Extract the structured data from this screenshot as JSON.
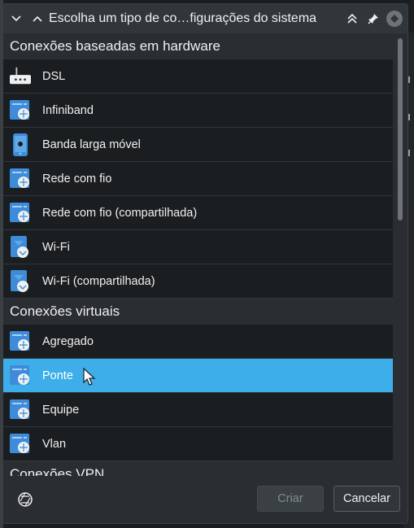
{
  "window": {
    "title": "Escolha um tipo de co…figurações do sistema",
    "buttons": {
      "create": "Criar",
      "cancel": "Cancelar"
    }
  },
  "sections": [
    {
      "title": "Conexões baseadas em hardware",
      "items": [
        {
          "label": "DSL",
          "icon": "dsl-modem-icon"
        },
        {
          "label": "Infiniband",
          "icon": "network-card-icon"
        },
        {
          "label": "Banda larga móvel",
          "icon": "mobile-phone-icon"
        },
        {
          "label": "Rede com fio",
          "icon": "wired-network-icon"
        },
        {
          "label": "Rede com fio (compartilhada)",
          "icon": "wired-network-icon"
        },
        {
          "label": "Wi-Fi",
          "icon": "wifi-icon"
        },
        {
          "label": "Wi-Fi (compartilhada)",
          "icon": "wifi-icon"
        }
      ]
    },
    {
      "title": "Conexões virtuais",
      "items": [
        {
          "label": "Agregado",
          "icon": "network-card-icon"
        },
        {
          "label": "Ponte",
          "icon": "network-card-icon",
          "selected": true
        },
        {
          "label": "Equipe",
          "icon": "network-card-icon"
        },
        {
          "label": "Vlan",
          "icon": "network-card-icon"
        }
      ]
    },
    {
      "title": "Conexões VPN",
      "items": []
    }
  ],
  "colors": {
    "selection": "#3daee9",
    "background": "#232629",
    "icon_blue": "#3d8bd9"
  }
}
